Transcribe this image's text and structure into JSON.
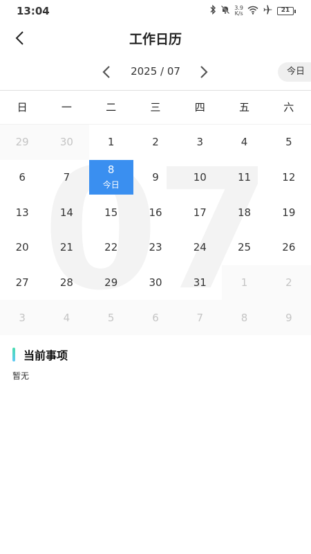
{
  "status_bar": {
    "time": "13:04",
    "speed_value": "3.9",
    "speed_unit": "K/s",
    "battery": "21",
    "icons": [
      "bluetooth-icon",
      "mute-bell-icon",
      "wifi-icon",
      "airplane-icon",
      "battery-icon"
    ]
  },
  "header": {
    "title": "工作日历",
    "back_icon": "chevron-left-icon"
  },
  "month_nav": {
    "label": "2025 / 07",
    "today_label": "今日",
    "prev_icon": "chevron-left-icon",
    "next_icon": "chevron-right-icon"
  },
  "calendar": {
    "watermark": "07",
    "weekdays": [
      "日",
      "一",
      "二",
      "三",
      "四",
      "五",
      "六"
    ],
    "days": [
      {
        "d": "29",
        "other": true
      },
      {
        "d": "30",
        "other": true
      },
      {
        "d": "1"
      },
      {
        "d": "2"
      },
      {
        "d": "3"
      },
      {
        "d": "4"
      },
      {
        "d": "5"
      },
      {
        "d": "6"
      },
      {
        "d": "7"
      },
      {
        "d": "8",
        "today": true,
        "sub": "今日"
      },
      {
        "d": "9"
      },
      {
        "d": "10"
      },
      {
        "d": "11"
      },
      {
        "d": "12"
      },
      {
        "d": "13"
      },
      {
        "d": "14"
      },
      {
        "d": "15"
      },
      {
        "d": "16"
      },
      {
        "d": "17"
      },
      {
        "d": "18"
      },
      {
        "d": "19"
      },
      {
        "d": "20"
      },
      {
        "d": "21"
      },
      {
        "d": "22"
      },
      {
        "d": "23"
      },
      {
        "d": "24"
      },
      {
        "d": "25"
      },
      {
        "d": "26"
      },
      {
        "d": "27"
      },
      {
        "d": "28"
      },
      {
        "d": "29"
      },
      {
        "d": "30"
      },
      {
        "d": "31"
      },
      {
        "d": "1",
        "other": true
      },
      {
        "d": "2",
        "other": true
      },
      {
        "d": "3",
        "other": true
      },
      {
        "d": "4",
        "other": true
      },
      {
        "d": "5",
        "other": true
      },
      {
        "d": "6",
        "other": true
      },
      {
        "d": "7",
        "other": true
      },
      {
        "d": "8",
        "other": true
      },
      {
        "d": "9",
        "other": true
      }
    ],
    "today_color": "#3a8ff0"
  },
  "current_items": {
    "title": "当前事项",
    "empty_text": "暂无"
  }
}
